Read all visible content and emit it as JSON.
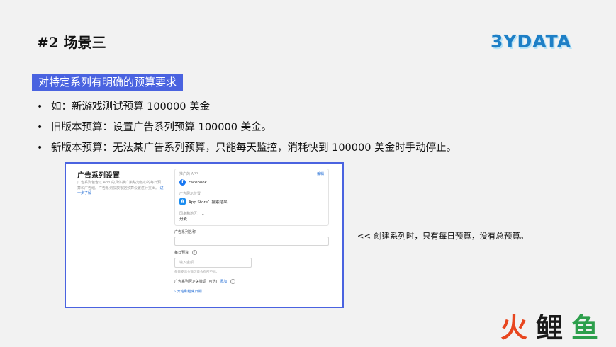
{
  "slide": {
    "title": "#2 场景三",
    "logo": "3YDATA",
    "section_tag": "对特定系列有明确的预算要求",
    "bullets": [
      "如：新游戏测试预算 100000 美金",
      "旧版本预算：设置广告系列预算 100000 美金。",
      "新版本预算：无法某广告系列预算，只能每天监控，消耗快到 100000 美金时手动停止。"
    ],
    "callout": "<< 创建系列时，只有每日预算，没有总预算。"
  },
  "screenshot": {
    "section_title": "广告系列设置",
    "section_desc": "广告系列包含以 App 的具体推广策略为核心的每日预算和广告组。广告系列投放根据预算设置进行支出。",
    "learn_more": "进一步了解",
    "card": {
      "promoted_app_label": "推广的 APP",
      "edit_label": "编辑",
      "app_name": "Facebook",
      "placement_label": "广告展示位置",
      "placement_value": "App Store：搜索结果",
      "region_label": "国家和地区：",
      "region_count": "1",
      "region_value": "丹麦"
    },
    "campaign_name_label": "广告系列名称",
    "campaign_name_value": "",
    "daily_budget_label": "每日预算",
    "daily_budget_placeholder": "输入金额",
    "daily_budget_hint": "每日支出金额可能会有所不同。",
    "negative_keywords_label": "广告系列否定关键词 (可选)",
    "negative_keywords_add": "添加",
    "date_link": "开始和结束日期"
  },
  "watermark": {
    "text": "火鲤鱼",
    "colors": [
      "#e8461f",
      "#1a1a1a",
      "#2d9f4c"
    ]
  },
  "colors": {
    "accent": "#4a63e0",
    "link": "#2a72d6",
    "logo": "#1e7fc6"
  }
}
